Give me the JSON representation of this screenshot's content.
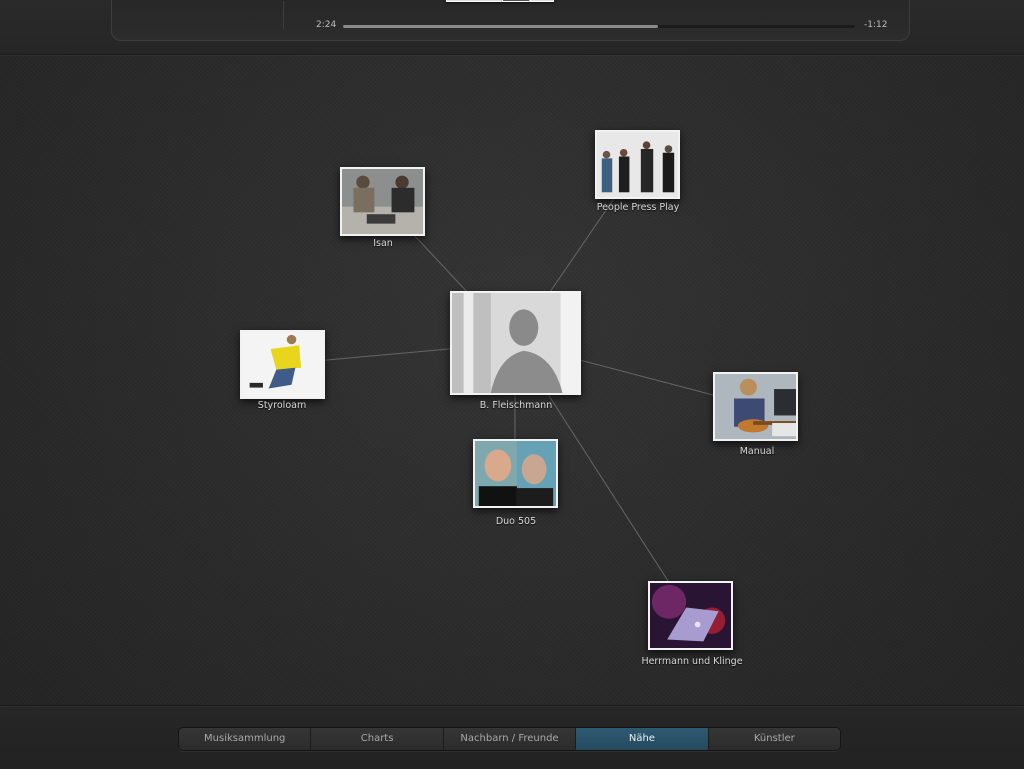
{
  "player": {
    "time_elapsed": "2:24",
    "time_remaining": "-1:12",
    "progress": 0.615
  },
  "network": {
    "center": {
      "name": "B. Fleischmann",
      "icon": "artist-photo-icon"
    },
    "related": [
      {
        "name": "Isan",
        "icon": "artist-photo-icon"
      },
      {
        "name": "People Press Play",
        "icon": "artist-photo-icon"
      },
      {
        "name": "Styroloam",
        "icon": "artist-photo-icon"
      },
      {
        "name": "Manual",
        "icon": "artist-photo-icon"
      },
      {
        "name": "Duo 505",
        "icon": "artist-photo-icon"
      },
      {
        "name": "Herrmann und Klinge",
        "icon": "artist-photo-icon"
      }
    ]
  },
  "tabs": [
    {
      "label": "Musiksammlung",
      "active": false
    },
    {
      "label": "Charts",
      "active": false
    },
    {
      "label": "Nachbarn / Freunde",
      "active": false
    },
    {
      "label": "Nähe",
      "active": true
    },
    {
      "label": "Künstler",
      "active": false
    }
  ],
  "colors": {
    "accent": "#2e5a72",
    "background": "#2b2b2b",
    "link": "#6a6a6a"
  }
}
